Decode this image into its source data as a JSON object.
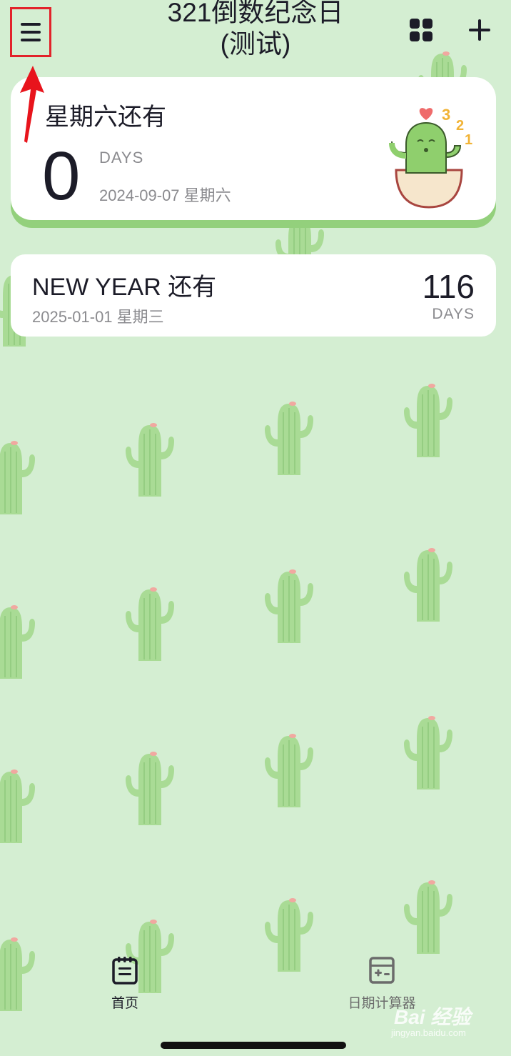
{
  "header": {
    "title_line1": "321倒数纪念日",
    "title_line2": "(测试)"
  },
  "hero_card": {
    "title": "星期六还有",
    "count": "0",
    "unit": "DAYS",
    "date": "2024-09-07 星期六",
    "image": "cactus-321-sticker"
  },
  "event_card": {
    "title": "NEW YEAR 还有",
    "date": "2025-01-01 星期三",
    "count": "116",
    "unit": "DAYS"
  },
  "bottom_nav": {
    "home_label": "首页",
    "calculator_label": "日期计算器"
  },
  "watermark": {
    "brand": "Bai 经验",
    "url": "jingyan.baidu.com"
  },
  "colors": {
    "background": "#d4eed2",
    "card_accent": "#93d07c",
    "highlight_box": "#e2232a"
  },
  "icons": [
    "menu-icon",
    "grid-icon",
    "plus-icon",
    "notebook-icon",
    "calculator-icon"
  ]
}
